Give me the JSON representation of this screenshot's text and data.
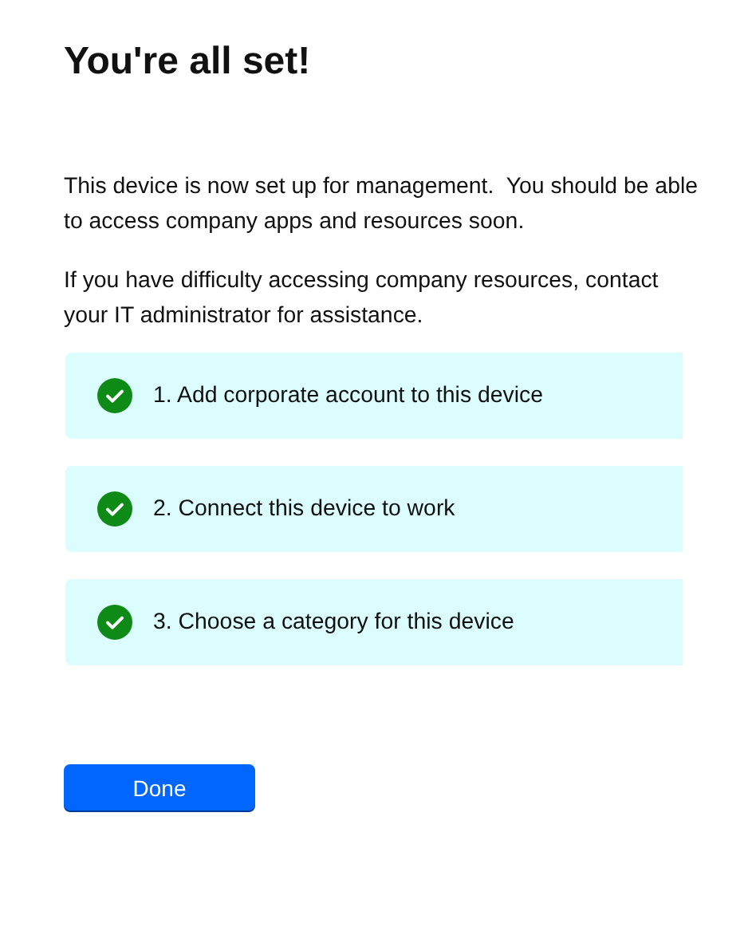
{
  "title": "You're all set!",
  "paragraphs": [
    "This device is now set up for management.  You should be able to access company apps and resources soon.",
    "If you have difficulty accessing company resources, contact your IT administrator for assistance."
  ],
  "steps": [
    {
      "label": "1. Add corporate account to this device",
      "completed": true
    },
    {
      "label": "2. Connect this device to work",
      "completed": true
    },
    {
      "label": "3. Choose a category for this device",
      "completed": true
    }
  ],
  "button": "Done"
}
